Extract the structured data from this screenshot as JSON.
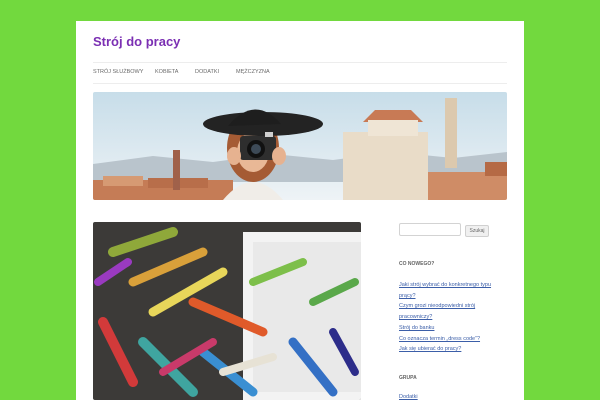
{
  "site": {
    "title": "Strój do pracy"
  },
  "nav": {
    "items": [
      "STRÓJ SŁUŻBOWY",
      "KOBIETA",
      "DODATKI",
      "MĘŻCZYZNA"
    ]
  },
  "sidebar": {
    "search": {
      "value": "",
      "button_label": "Szukaj"
    },
    "recent_posts": {
      "title": "CO NOWEGO?",
      "items": [
        "Jaki strój wybrać do konkretnego typu prący?",
        "Czym grozi nieodpowiedni strój pracowniczy?",
        "Strój do banku",
        "Co oznacza termin „dress code”?",
        "Jak się ubierać do pracy?"
      ]
    },
    "categories": {
      "title": "GRUPA",
      "items": [
        "Dodatki"
      ]
    }
  },
  "colors": {
    "background": "#72d93e",
    "site_title": "#7b2fb3",
    "link": "#3b5ea8"
  }
}
